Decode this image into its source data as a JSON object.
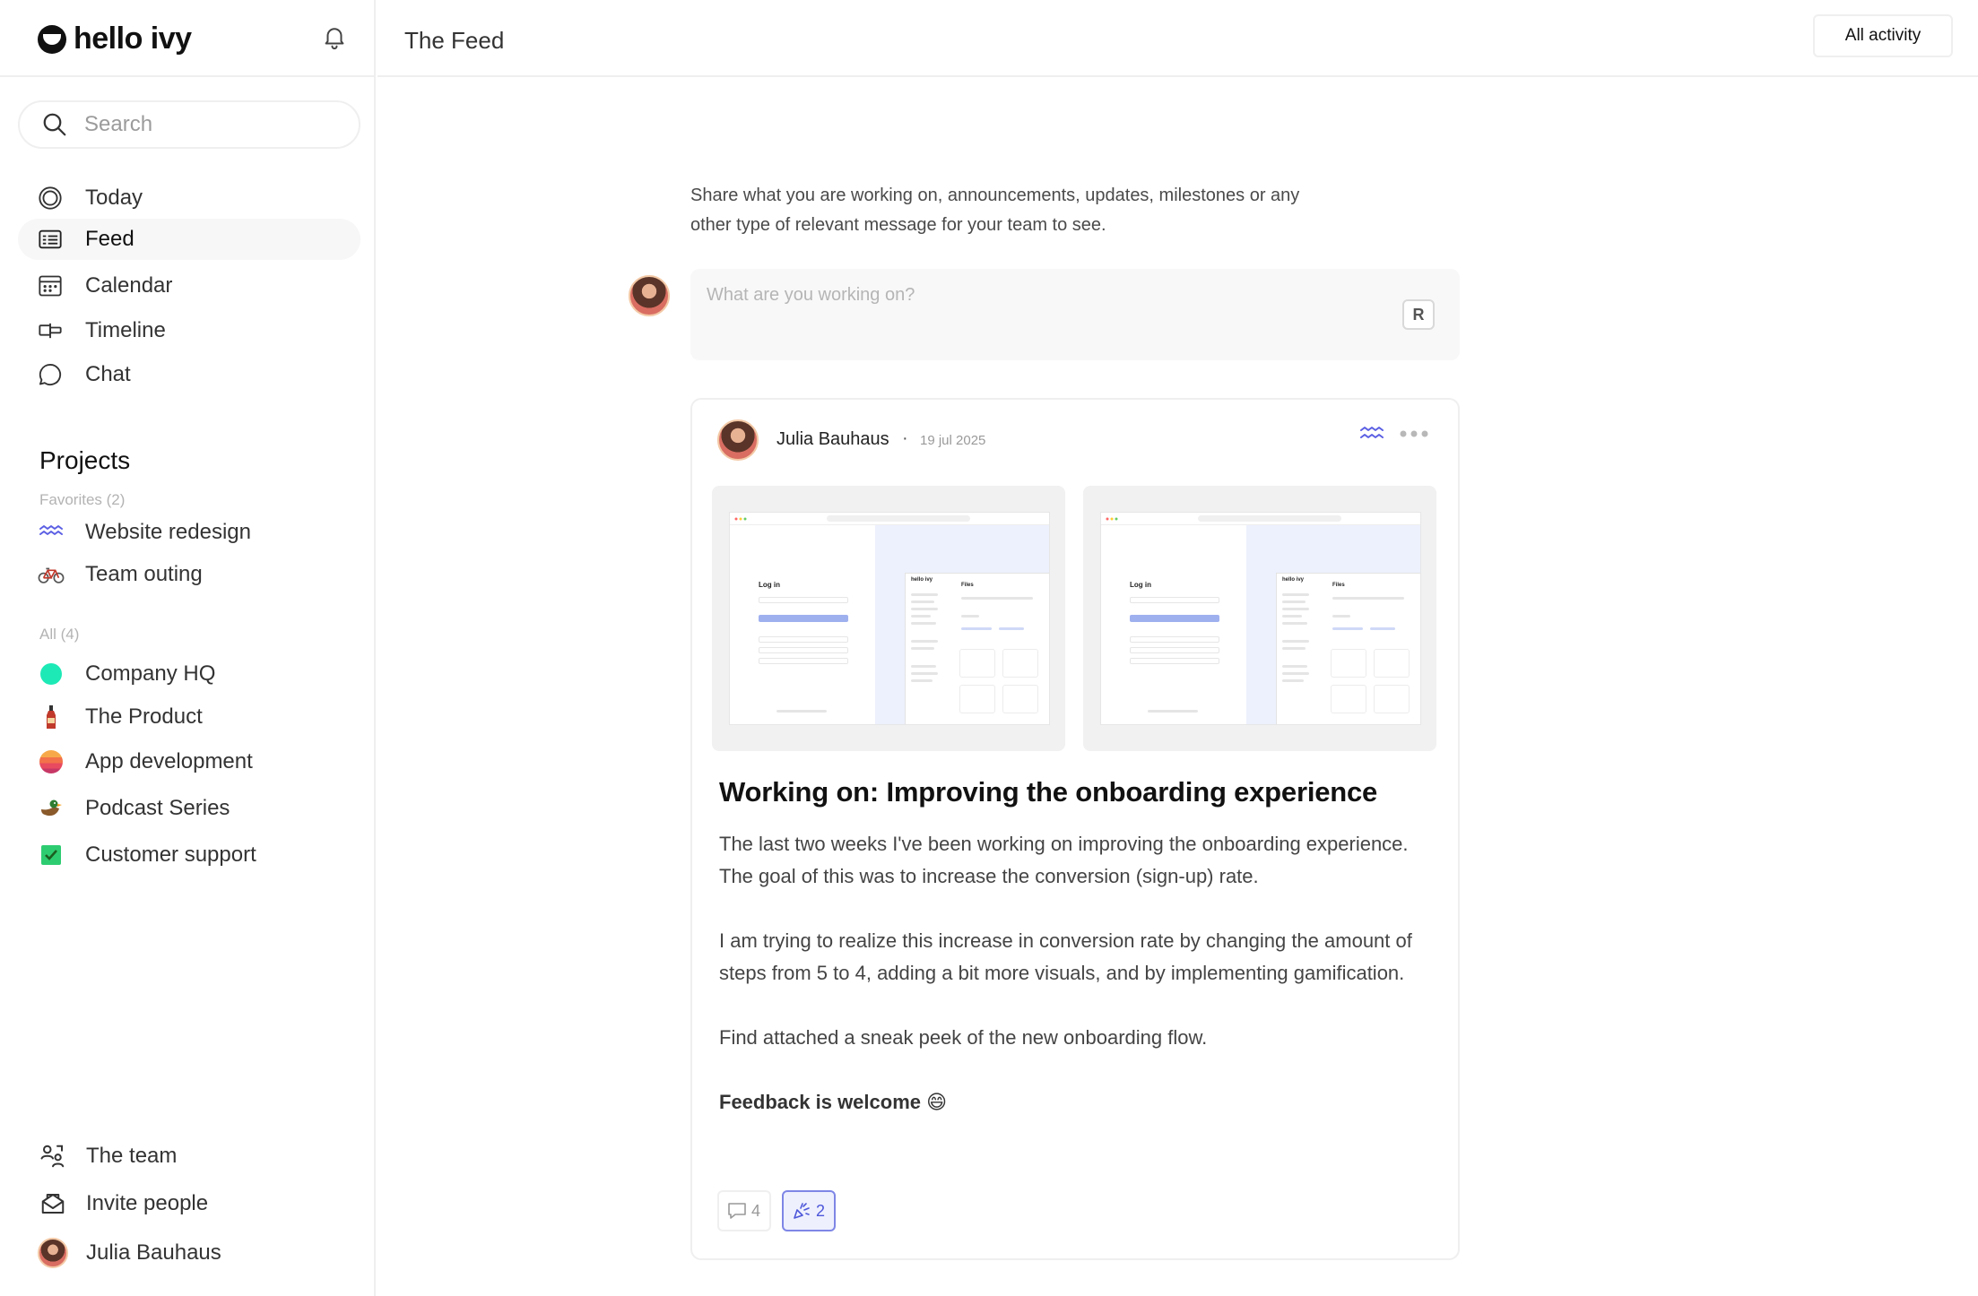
{
  "app": {
    "brand": "hello ivy"
  },
  "search": {
    "placeholder": "Search"
  },
  "nav": [
    {
      "label": "Today",
      "icon": "target-icon"
    },
    {
      "label": "Feed",
      "icon": "feed-icon",
      "active": true
    },
    {
      "label": "Calendar",
      "icon": "calendar-icon"
    },
    {
      "label": "Timeline",
      "icon": "timeline-icon"
    },
    {
      "label": "Chat",
      "icon": "chat-icon"
    }
  ],
  "projects": {
    "title": "Projects",
    "favorites_label": "Favorites (2)",
    "favorites": [
      {
        "label": "Website redesign",
        "icon": "wave-icon",
        "color": "#5b5fe3"
      },
      {
        "label": "Team outing",
        "icon": "bicycle-icon"
      }
    ],
    "all_label": "All (4)",
    "all": [
      {
        "label": "Company HQ",
        "icon": "green-circle-icon",
        "color": "#1de9b6"
      },
      {
        "label": "The Product",
        "icon": "bottle-icon"
      },
      {
        "label": "App development",
        "icon": "sunset-icon"
      },
      {
        "label": "Podcast Series",
        "icon": "duck-icon"
      },
      {
        "label": "Customer support",
        "icon": "check-box-icon"
      }
    ]
  },
  "bottom": {
    "team": "The team",
    "invite": "Invite people",
    "user": "Julia Bauhaus"
  },
  "header": {
    "title": "The Feed",
    "filter": "All activity"
  },
  "composer": {
    "intro": "Share what you are working on, announcements, updates, milestones or any other type of relevant message for your team to see.",
    "placeholder": "What are you working on?",
    "badge": "R"
  },
  "post": {
    "author": "Julia Bauhaus",
    "separator": "·",
    "date": "19 jul 2025",
    "title": "Working on: Improving the onboarding experience",
    "paragraphs": [
      "The last two weeks I've been working on improving the onboarding experience. The goal of this was to increase the conversion (sign-up) rate.",
      "I am trying to realize this increase in conversion rate by changing the amount of steps from 5 to 4, adding a bit more visuals, and by implementing gamification.",
      "Find attached a sneak peek of the new onboarding flow."
    ],
    "closing": "Feedback is welcome 😄",
    "attachments": [
      {
        "login_title": "Log in",
        "app_name": "hello ivy",
        "panel_title": "Files"
      },
      {
        "login_title": "Log in",
        "app_name": "hello ivy",
        "panel_title": "Files"
      }
    ],
    "reactions": {
      "comments": "4",
      "claps": "2"
    }
  }
}
